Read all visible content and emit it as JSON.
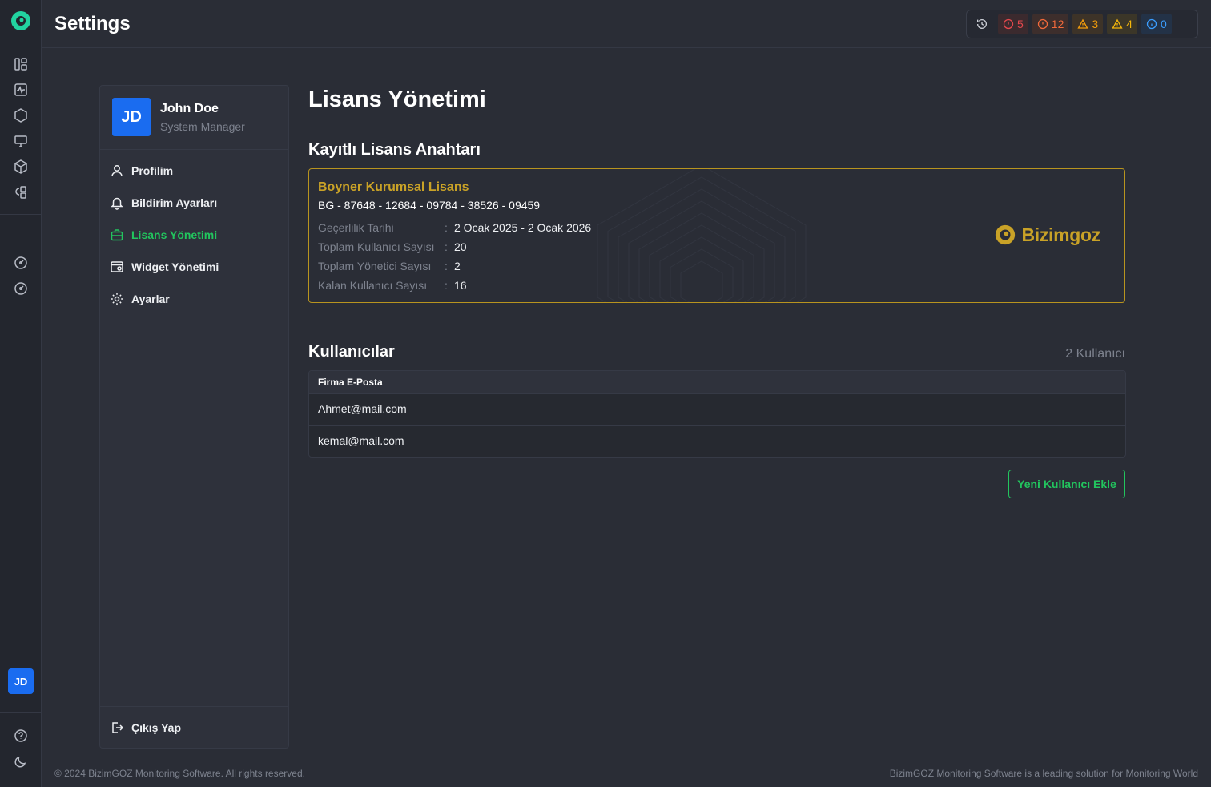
{
  "header": {
    "title": "Settings"
  },
  "alerts": [
    {
      "kind": "critical",
      "count": "5",
      "color": "#e5484d"
    },
    {
      "kind": "error",
      "count": "12",
      "color": "#f26a3b"
    },
    {
      "kind": "warning",
      "count": "3",
      "color": "#f59e0b"
    },
    {
      "kind": "minor",
      "count": "4",
      "color": "#f5b70b"
    },
    {
      "kind": "info",
      "count": "0",
      "color": "#3b9eff"
    }
  ],
  "rail": {
    "avatar_initials": "JD"
  },
  "profile": {
    "initials": "JD",
    "name": "John Doe",
    "role": "System Manager"
  },
  "menu": {
    "items": [
      {
        "label": "Profilim",
        "icon": "user-icon"
      },
      {
        "label": "Bildirim Ayarları",
        "icon": "bell-icon"
      },
      {
        "label": "Lisans Yönetimi",
        "icon": "briefcase-icon",
        "active": true
      },
      {
        "label": "Widget Yönetimi",
        "icon": "widget-icon"
      },
      {
        "label": "Ayarlar",
        "icon": "gear-icon"
      }
    ],
    "logout": "Çıkış Yap"
  },
  "main": {
    "title": "Lisans Yönetimi",
    "license_section_title": "Kayıtlı Lisans Anahtarı",
    "license": {
      "name": "Boyner Kurumsal Lisans",
      "key": "BG - 87648 - 12684 - 09784 - 38526 - 09459",
      "rows": [
        {
          "label": "Geçerlilik Tarihi",
          "value": "2 Ocak 2025 - 2 Ocak 2026"
        },
        {
          "label": "Toplam Kullanıcı Sayısı",
          "value": "20"
        },
        {
          "label": "Toplam Yönetici Sayısı",
          "value": "2"
        },
        {
          "label": "Kalan Kullanıcı Sayısı",
          "value": "16"
        }
      ],
      "separator": ":",
      "brand": "Bizimgoz",
      "accent_color": "#c9a227"
    },
    "users_section_title": "Kullanıcılar",
    "users_count": "2 Kullanıcı",
    "table": {
      "header": "Firma E-Posta",
      "rows": [
        "Ahmet@mail.com",
        "kemal@mail.com"
      ]
    },
    "add_button": "Yeni Kullanıcı Ekle"
  },
  "footer": {
    "copyright": "© 2024 BizimGOZ Monitoring Software. All rights reserved.",
    "tagline": "BizimGOZ Monitoring Software is a leading solution for Monitoring World"
  }
}
